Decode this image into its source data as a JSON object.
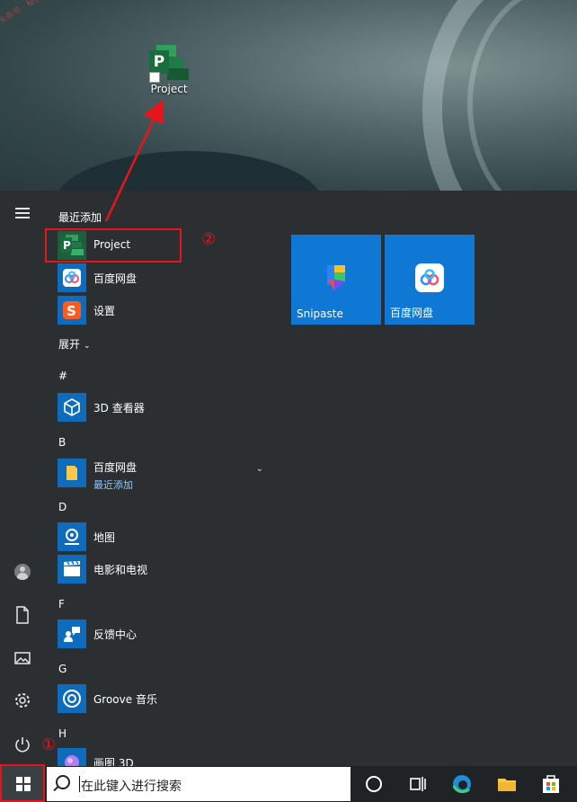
{
  "desktop": {
    "watermark": "头条号 · 秘快科技",
    "project_shortcut_label": "Project"
  },
  "start_menu": {
    "recently_added_header": "最近添加",
    "recent_apps": [
      {
        "name": "Project",
        "icon": "project-icon"
      },
      {
        "name": "百度网盘",
        "icon": "baidu-netdisk-icon"
      },
      {
        "name": "设置",
        "icon": "sogou-settings-icon"
      }
    ],
    "expand_label": "展开",
    "groups": [
      {
        "letter": "#",
        "apps": [
          {
            "name": "3D 查看器"
          }
        ]
      },
      {
        "letter": "B",
        "apps": [
          {
            "name": "百度网盘",
            "sub": "最近添加"
          }
        ]
      },
      {
        "letter": "D",
        "apps": [
          {
            "name": "地图"
          },
          {
            "name": "电影和电视"
          }
        ]
      },
      {
        "letter": "F",
        "apps": [
          {
            "name": "反馈中心"
          }
        ]
      },
      {
        "letter": "G",
        "apps": [
          {
            "name": "Groove 音乐"
          }
        ]
      },
      {
        "letter": "H",
        "apps": [
          {
            "name": "画图 3D"
          }
        ]
      }
    ],
    "tiles": [
      {
        "name": "Snipaste",
        "icon": "snipaste-icon"
      },
      {
        "name": "百度网盘",
        "icon": "baidu-netdisk-icon"
      }
    ]
  },
  "taskbar": {
    "search_placeholder": "在此键入进行搜索"
  },
  "annotations": {
    "circle_1": "①",
    "circle_2": "②"
  },
  "colors": {
    "annotation_red": "#e8141b",
    "tile_blue": "#0f78d4",
    "start_bg": "#2b2f32"
  }
}
